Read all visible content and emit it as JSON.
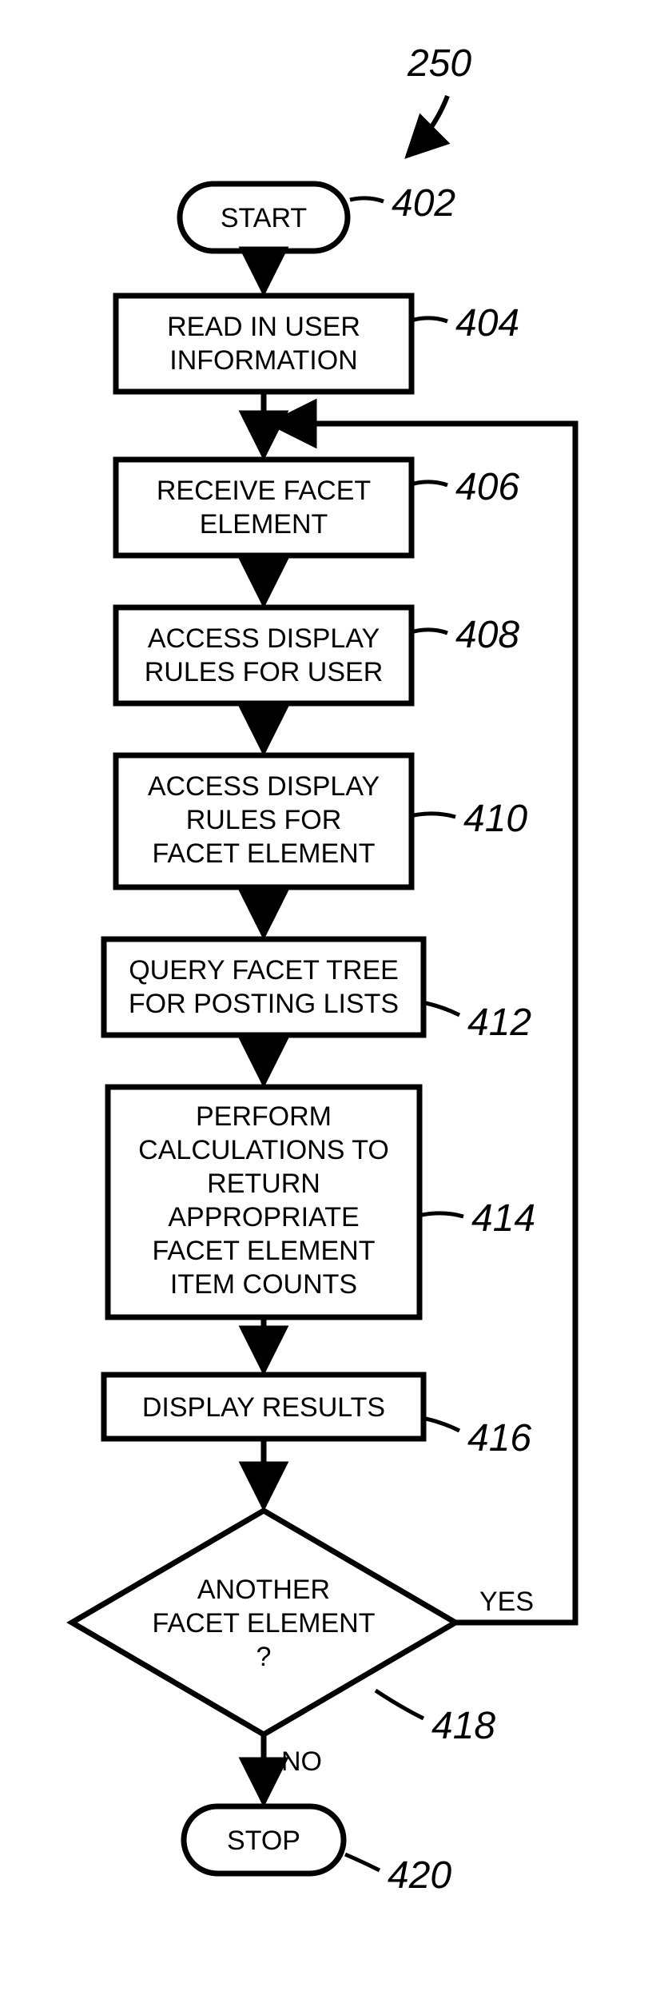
{
  "chart_data": {
    "type": "flowchart",
    "title_ref": "250",
    "nodes": [
      {
        "id": "402",
        "kind": "terminator",
        "label": "START",
        "ref": "402"
      },
      {
        "id": "404",
        "kind": "process",
        "label": "READ IN USER INFORMATION",
        "ref": "404"
      },
      {
        "id": "406",
        "kind": "process",
        "label": "RECEIVE FACET ELEMENT",
        "ref": "406"
      },
      {
        "id": "408",
        "kind": "process",
        "label": "ACCESS DISPLAY RULES FOR USER",
        "ref": "408"
      },
      {
        "id": "410",
        "kind": "process",
        "label": "ACCESS DISPLAY RULES FOR FACET ELEMENT",
        "ref": "410"
      },
      {
        "id": "412",
        "kind": "process",
        "label": "QUERY FACET TREE FOR POSTING LISTS",
        "ref": "412"
      },
      {
        "id": "414",
        "kind": "process",
        "label": "PERFORM CALCULATIONS TO RETURN APPROPRIATE FACET ELEMENT ITEM COUNTS",
        "ref": "414"
      },
      {
        "id": "416",
        "kind": "process",
        "label": "DISPLAY RESULTS",
        "ref": "416"
      },
      {
        "id": "418",
        "kind": "decision",
        "label": "ANOTHER FACET ELEMENT ?",
        "ref": "418"
      },
      {
        "id": "420",
        "kind": "terminator",
        "label": "STOP",
        "ref": "420"
      }
    ],
    "edges": [
      {
        "from": "402",
        "to": "404"
      },
      {
        "from": "404",
        "to": "406"
      },
      {
        "from": "406",
        "to": "408"
      },
      {
        "from": "408",
        "to": "410"
      },
      {
        "from": "410",
        "to": "412"
      },
      {
        "from": "412",
        "to": "414"
      },
      {
        "from": "414",
        "to": "416"
      },
      {
        "from": "416",
        "to": "418"
      },
      {
        "from": "418",
        "to": "420",
        "label": "NO"
      },
      {
        "from": "418",
        "to": "406",
        "label": "YES"
      }
    ]
  },
  "labels": {
    "title_ref": "250",
    "start": "START",
    "stop": "STOP",
    "yes": "YES",
    "no": "NO",
    "n402": "402",
    "n404": "404",
    "n406": "406",
    "n408": "408",
    "n410": "410",
    "n412": "412",
    "n414": "414",
    "n416": "416",
    "n418": "418",
    "n420": "420",
    "t404a": "READ IN USER",
    "t404b": "INFORMATION",
    "t406a": "RECEIVE FACET",
    "t406b": "ELEMENT",
    "t408a": "ACCESS DISPLAY",
    "t408b": "RULES FOR USER",
    "t410a": "ACCESS DISPLAY",
    "t410b": "RULES FOR",
    "t410c": "FACET ELEMENT",
    "t412a": "QUERY FACET TREE",
    "t412b": "FOR POSTING LISTS",
    "t414a": "PERFORM",
    "t414b": "CALCULATIONS TO",
    "t414c": "RETURN",
    "t414d": "APPROPRIATE",
    "t414e": "FACET ELEMENT",
    "t414f": "ITEM COUNTS",
    "t416": "DISPLAY RESULTS",
    "t418a": "ANOTHER",
    "t418b": "FACET ELEMENT",
    "t418c": "?"
  }
}
